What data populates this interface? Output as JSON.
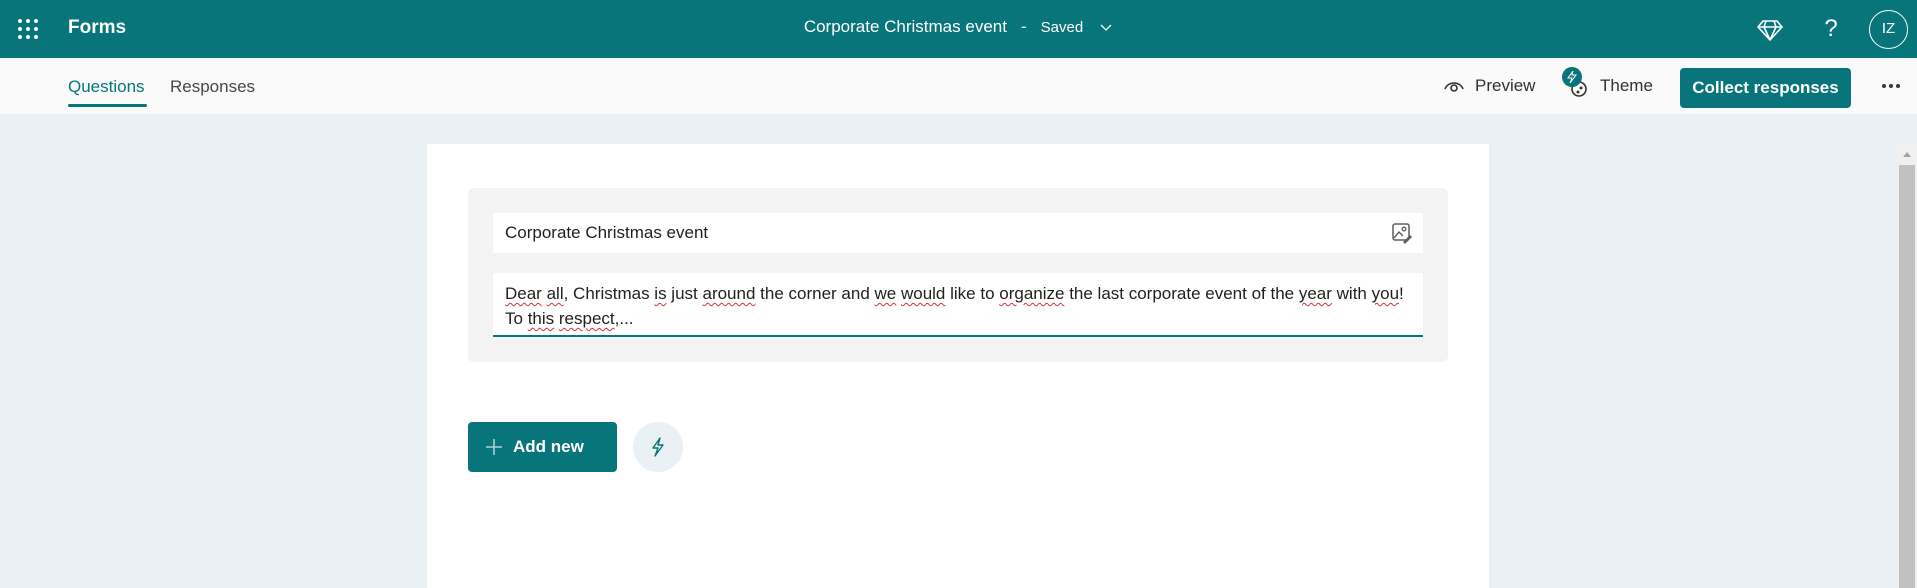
{
  "topbar": {
    "app_name": "Forms",
    "document_title": "Corporate Christmas event",
    "separator": "-",
    "save_status": "Saved",
    "icons": [
      "waffle-icon",
      "diamond-icon",
      "help-icon"
    ],
    "help_glyph": "?",
    "avatar_initials": "IZ"
  },
  "subnav": {
    "tabs": [
      {
        "label": "Questions",
        "active": true
      },
      {
        "label": "Responses",
        "active": false
      }
    ],
    "preview_label": "Preview",
    "theme_label": "Theme",
    "collect_label": "Collect responses"
  },
  "form": {
    "title": "Corporate Christmas event",
    "description_words": [
      {
        "t": "Dear",
        "sp": true
      },
      {
        "t": " ",
        "sp": false
      },
      {
        "t": "all",
        "sp": true
      },
      {
        "t": ", Christmas ",
        "sp": false
      },
      {
        "t": "is",
        "sp": true
      },
      {
        "t": " just ",
        "sp": false
      },
      {
        "t": "around",
        "sp": true
      },
      {
        "t": " the corner and ",
        "sp": false
      },
      {
        "t": "we",
        "sp": true
      },
      {
        "t": " ",
        "sp": false
      },
      {
        "t": "would",
        "sp": true
      },
      {
        "t": " like to ",
        "sp": false
      },
      {
        "t": "organize",
        "sp": true
      },
      {
        "t": " the last corporate event of the ",
        "sp": false
      },
      {
        "t": "year",
        "sp": true
      },
      {
        "t": " with ",
        "sp": false
      },
      {
        "t": "you",
        "sp": true
      },
      {
        "t": "! To ",
        "sp": false
      },
      {
        "t": "this",
        "sp": true
      },
      {
        "t": " ",
        "sp": false
      },
      {
        "t": "respect",
        "sp": true
      },
      {
        "t": ",...",
        "sp": false
      }
    ],
    "add_new_label": "Add new"
  },
  "colors": {
    "brand": "#077579",
    "page_bg": "#e9f1f4",
    "spellcheck": "#d13438"
  }
}
